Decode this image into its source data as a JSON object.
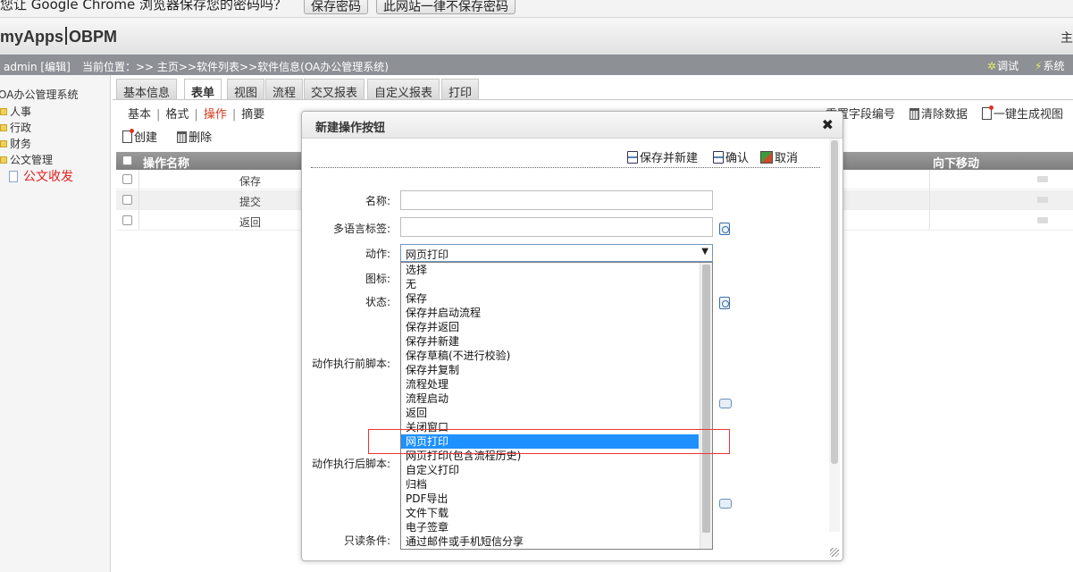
{
  "infobar": {
    "message": "您让 Google Chrome 浏览器保存您的密码吗？",
    "save_label": "保存密码",
    "never_label": "此网站一律不保存密码"
  },
  "app": {
    "logo_left": "myApps",
    "logo_right": "OBPM",
    "header_right": "主"
  },
  "location": {
    "user": "admin [编辑]",
    "path": "当前位置：>> 主页>>软件列表>>软件信息(OA办公管理系统)",
    "debug_label": "调试",
    "system_label": "系统"
  },
  "tree": {
    "root": "OA办公管理系统",
    "items": [
      "人事",
      "行政",
      "财务",
      "公文管理"
    ],
    "active": "公文收发"
  },
  "tabs": [
    "基本信息",
    "表单",
    "视图",
    "流程",
    "交叉报表",
    "自定义报表",
    "打印"
  ],
  "subtabs": {
    "basic": "基本",
    "format": "格式",
    "operation": "操作",
    "summary": "摘要"
  },
  "right_tools": {
    "reset_label": "重置字段编号",
    "clear_label": "清除数据",
    "generate_label": "一键生成视图"
  },
  "actions": {
    "create_label": "创建",
    "delete_label": "删除"
  },
  "grid": {
    "col_name": "操作名称",
    "col_move": "向下移动",
    "rows": [
      "保存",
      "提交",
      "返回"
    ]
  },
  "dialog": {
    "title": "新建操作按钮",
    "close_glyph": "✖",
    "save_new_label": "保存并新建",
    "confirm_label": "确认",
    "cancel_label": "取消",
    "labels": {
      "name": "名称:",
      "i18n": "多语言标签:",
      "action": "动作:",
      "icon": "图标:",
      "state": "状态:",
      "before_script": "动作执行前脚本:",
      "after_script": "动作执行后脚本:",
      "readonly": "只读条件:"
    },
    "action_value": "网页打印",
    "options": [
      "选择",
      "无",
      "保存",
      "保存并启动流程",
      "保存并返回",
      "保存并新建",
      "保存草稿(不进行校验)",
      "保存并复制",
      "流程处理",
      "流程启动",
      "返回",
      "关闭窗口",
      "网页打印",
      "网页打印(包含流程历史)",
      "自定义打印",
      "归档",
      "PDF导出",
      "文件下载",
      "电子签章",
      "通过邮件或手机短信分享"
    ],
    "highlighted_index": 12
  },
  "colors": {
    "highlight": "#1e90ff",
    "active_tree": "#e02020",
    "annotation": "#e33333"
  }
}
